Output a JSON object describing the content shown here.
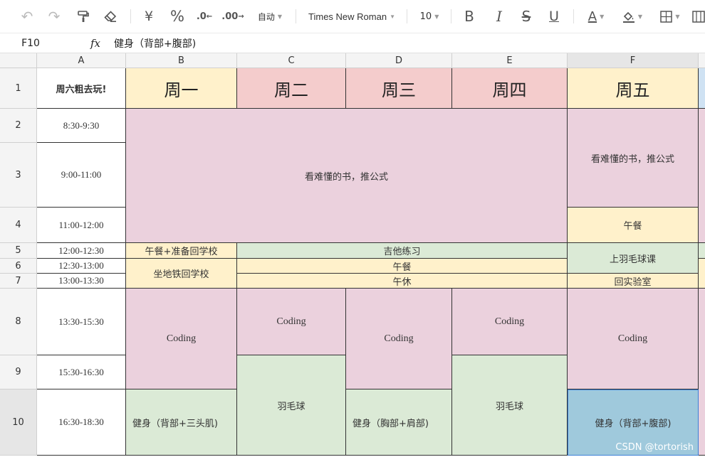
{
  "toolbar": {
    "font_size_mode": "自动",
    "font_name": "Times New Roman",
    "font_size": "10"
  },
  "formula_bar": {
    "cell_ref": "F10",
    "fx_label": "fx",
    "content": "健身（背部+腹部)"
  },
  "columns": [
    "A",
    "B",
    "C",
    "D",
    "E",
    "F"
  ],
  "rows": [
    "1",
    "2",
    "3",
    "4",
    "5",
    "6",
    "7",
    "8",
    "9",
    "10"
  ],
  "sheet": {
    "a1": "周六粗去玩!",
    "days": [
      "周一",
      "周二",
      "周三",
      "周四",
      "周五"
    ],
    "times": [
      "8:30-9:30",
      "9:00-11:00",
      "11:00-12:00",
      "12:00-12:30",
      "12:30-13:00",
      "13:00-13:30",
      "13:30-15:30",
      "15:30-16:30",
      "16:30-18:30"
    ],
    "study_main": "看难懂的书，推公式",
    "study_fri": "看难懂的书，推公式",
    "lunch_fri": "午餐",
    "b5": "午餐+准备回学校",
    "b6": "坐地铁回学校",
    "cde5": "吉他练习",
    "cde6": "午餐",
    "cde7": "午休",
    "f5": "上羽毛球课",
    "f7": "回实验室",
    "coding": "Coding",
    "badminton": "羽毛球",
    "b10": "健身（背部+三头肌)",
    "d10": "健身（胸部+肩部)",
    "f10": "健身（背部+腹部)"
  },
  "watermark": "CSDN @tortorish"
}
